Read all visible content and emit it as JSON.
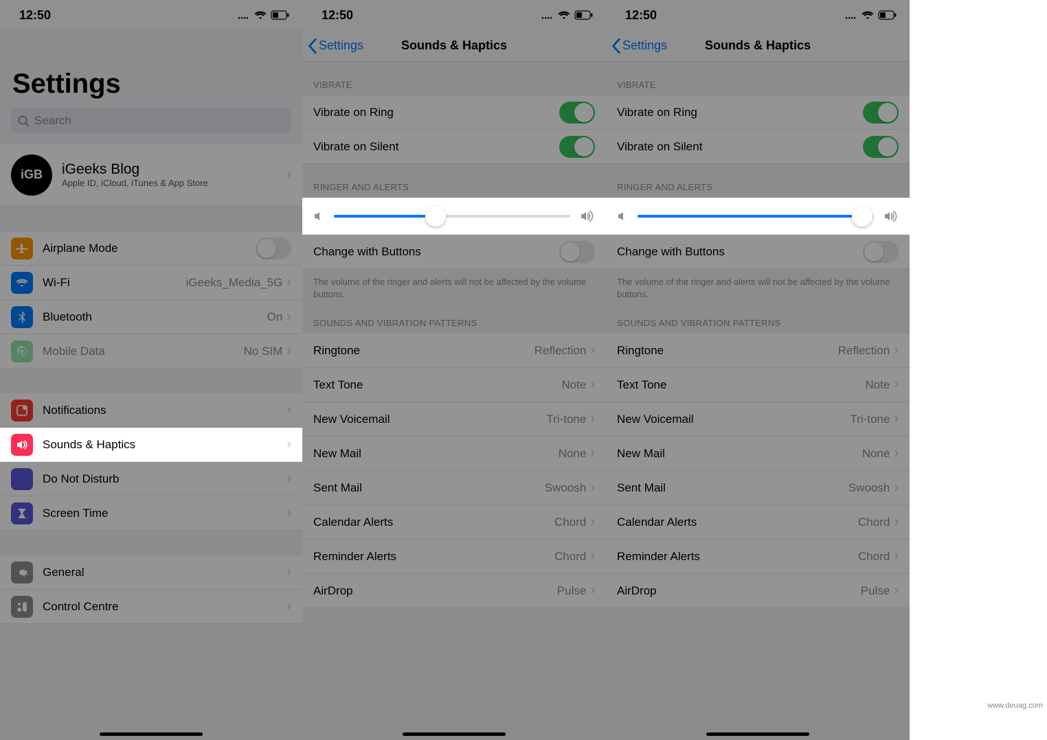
{
  "status": {
    "time": "12:50"
  },
  "screen1": {
    "title": "Settings",
    "searchPlaceholder": "Search",
    "profile": {
      "avatar": "iGB",
      "name": "iGeeks Blog",
      "subtitle": "Apple ID, iCloud, iTunes & App Store"
    },
    "rows1": [
      {
        "key": "airplane",
        "label": "Airplane Mode",
        "icon_bg": "#ff9500",
        "type": "toggle",
        "on": false
      },
      {
        "key": "wifi",
        "label": "Wi-Fi",
        "icon_bg": "#007aff",
        "type": "value",
        "value": "iGeeks_Media_5G"
      },
      {
        "key": "bluetooth",
        "label": "Bluetooth",
        "icon_bg": "#007aff",
        "type": "value",
        "value": "On"
      },
      {
        "key": "mobiledata",
        "label": "Mobile Data",
        "icon_bg": "#34c759",
        "type": "value",
        "value": "No SIM",
        "disabled": true
      }
    ],
    "rows2": [
      {
        "key": "notifications",
        "label": "Notifications",
        "icon_bg": "#ff3b30"
      },
      {
        "key": "sounds",
        "label": "Sounds & Haptics",
        "icon_bg": "#ff2d55",
        "highlight": true
      },
      {
        "key": "dnd",
        "label": "Do Not Disturb",
        "icon_bg": "#5856d6"
      },
      {
        "key": "screentime",
        "label": "Screen Time",
        "icon_bg": "#5856d6"
      }
    ],
    "rows3": [
      {
        "key": "general",
        "label": "General",
        "icon_bg": "#8e8e93"
      },
      {
        "key": "controlcentre",
        "label": "Control Centre",
        "icon_bg": "#8e8e93"
      }
    ]
  },
  "sounds": {
    "back": "Settings",
    "title": "Sounds & Haptics",
    "section_vibrate": "VIBRATE",
    "vibrate_ring": "Vibrate on Ring",
    "vibrate_silent": "Vibrate on Silent",
    "section_ringer": "RINGER AND ALERTS",
    "change_buttons": "Change with Buttons",
    "change_footer": "The volume of the ringer and alerts will not be affected by the volume buttons.",
    "section_patterns": "SOUNDS AND VIBRATION PATTERNS",
    "patterns": [
      {
        "label": "Ringtone",
        "value": "Reflection"
      },
      {
        "label": "Text Tone",
        "value": "Note"
      },
      {
        "label": "New Voicemail",
        "value": "Tri-tone"
      },
      {
        "label": "New Mail",
        "value": "None"
      },
      {
        "label": "Sent Mail",
        "value": "Swoosh"
      },
      {
        "label": "Calendar Alerts",
        "value": "Chord"
      },
      {
        "label": "Reminder Alerts",
        "value": "Chord"
      },
      {
        "label": "AirDrop",
        "value": "Pulse"
      }
    ],
    "slider_b_pct": 43,
    "slider_c_pct": 95
  },
  "watermark": "www.deuag.com"
}
